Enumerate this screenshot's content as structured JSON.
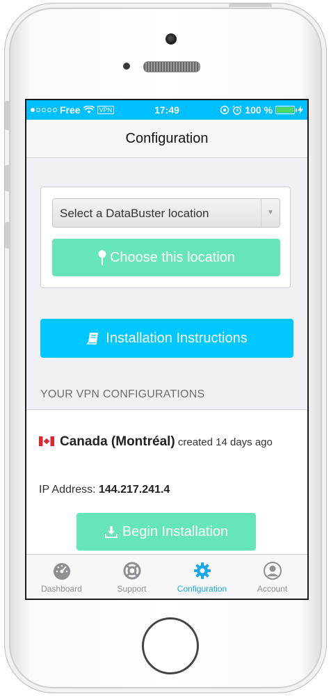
{
  "status_bar": {
    "carrier": "Free",
    "vpn": "VPN",
    "time": "17:49",
    "battery": "100 %"
  },
  "nav": {
    "title": "Configuration"
  },
  "location_card": {
    "select_placeholder": "Select a DataBuster location",
    "choose_label": "Choose this location"
  },
  "install_instructions_label": "Installation Instructions",
  "section_header": "YOUR VPN CONFIGURATIONS",
  "configuration": {
    "country": "Canada (Montréal)",
    "created": "created 14 days ago",
    "ip_label": "IP Address:",
    "ip_value": "144.217.241.4",
    "begin_label": "Begin Installation"
  },
  "tabs": [
    {
      "label": "Dashboard",
      "icon": "speedometer-icon",
      "active": false
    },
    {
      "label": "Support",
      "icon": "lifebuoy-icon",
      "active": false
    },
    {
      "label": "Configuration",
      "icon": "gear-icon",
      "active": true
    },
    {
      "label": "Account",
      "icon": "user-circle-icon",
      "active": false
    }
  ],
  "colors": {
    "status_bar": "#00bfff",
    "primary_button": "#00c8ff",
    "accent_green": "#66e6b8",
    "active_tab": "#1aa7e8"
  }
}
